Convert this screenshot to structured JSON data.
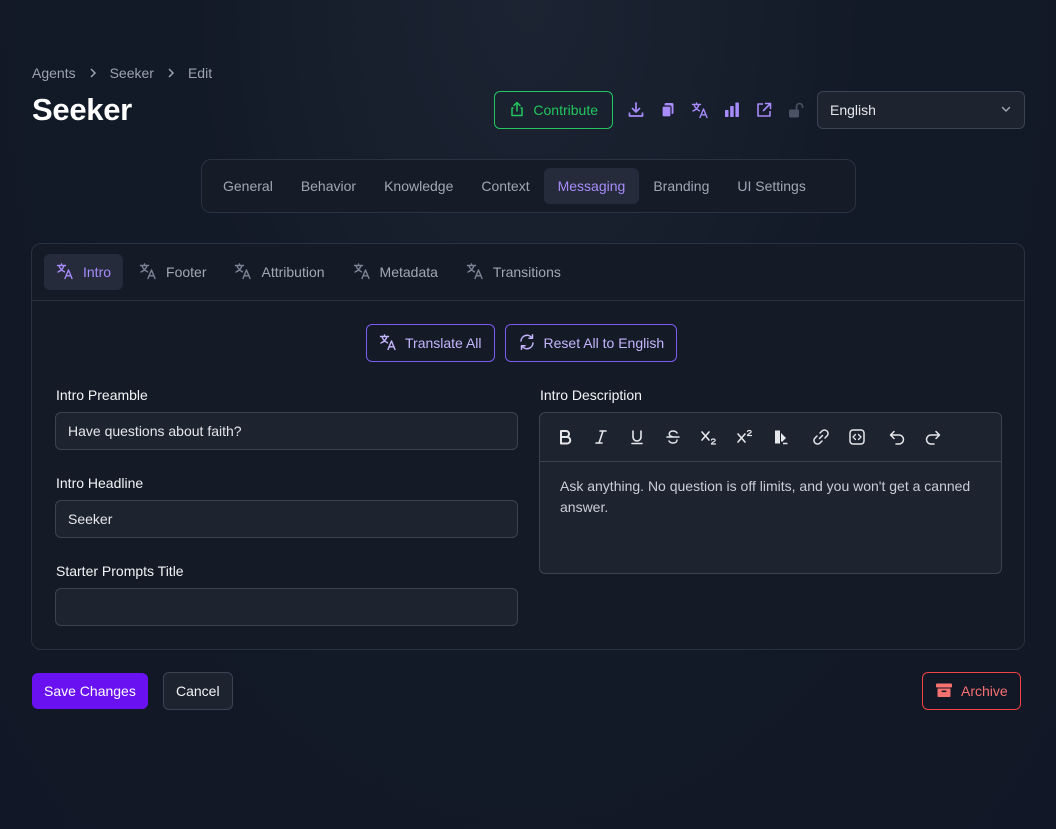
{
  "breadcrumb": [
    "Agents",
    "Seeker",
    "Edit"
  ],
  "page_title": "Seeker",
  "header": {
    "contribute_label": "Contribute",
    "icons": [
      "download-icon",
      "copy-icon",
      "translate-icon",
      "bar-chart-icon",
      "external-link-icon",
      "unlock-icon"
    ],
    "language": "English"
  },
  "main_tabs": [
    "General",
    "Behavior",
    "Knowledge",
    "Context",
    "Messaging",
    "Branding",
    "UI Settings"
  ],
  "main_tab_active": "Messaging",
  "sub_tabs": [
    "Intro",
    "Footer",
    "Attribution",
    "Metadata",
    "Transitions"
  ],
  "sub_tab_active": "Intro",
  "actions": {
    "translate_all": "Translate All",
    "reset_all": "Reset All to English"
  },
  "fields": {
    "intro_preamble": {
      "label": "Intro Preamble",
      "value": "Have questions about faith?"
    },
    "intro_headline": {
      "label": "Intro Headline",
      "value": "Seeker"
    },
    "starter_prompts_title": {
      "label": "Starter Prompts Title",
      "value": ""
    },
    "intro_description": {
      "label": "Intro Description",
      "value": "Ask anything. No question is off limits, and you won't get a canned answer."
    }
  },
  "editor_toolbar": [
    "bold-icon",
    "italic-icon",
    "underline-icon",
    "strikethrough-icon",
    "subscript-icon",
    "superscript-icon",
    "highlight-icon",
    "link-icon",
    "code-icon",
    "undo-icon",
    "redo-icon"
  ],
  "footer": {
    "save_label": "Save Changes",
    "cancel_label": "Cancel",
    "archive_label": "Archive"
  },
  "colors": {
    "accent_purple": "#a78bfa",
    "primary_button": "#6a11f2",
    "success_green": "#22c55e",
    "danger_red": "#ef4444",
    "background": "#121826"
  }
}
